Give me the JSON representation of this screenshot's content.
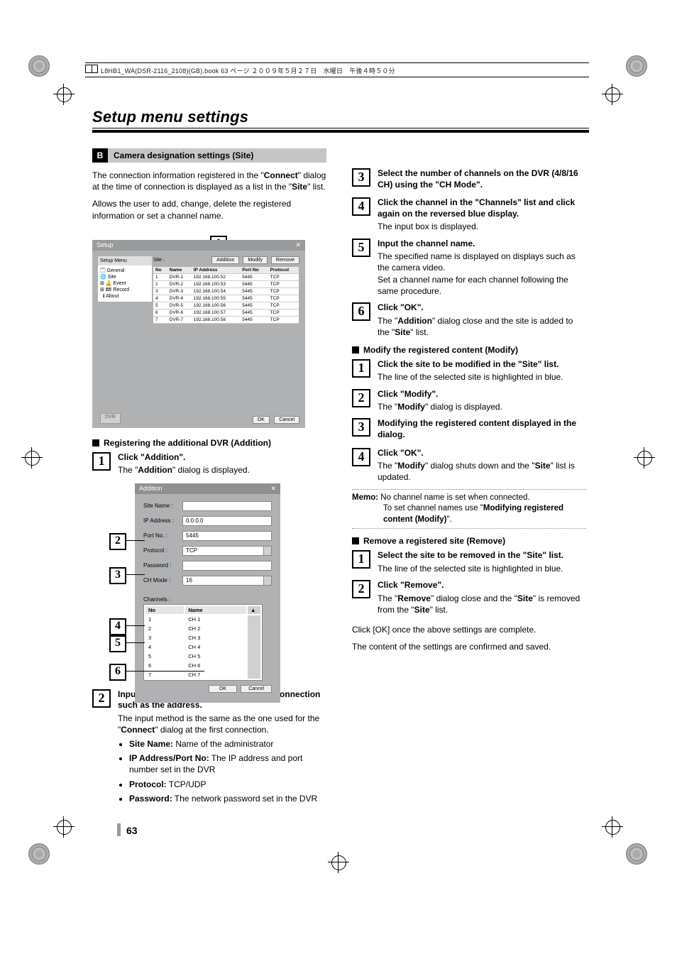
{
  "meta_header": "L8HB1_WA(DSR-2116_2108)(GB).book   63 ページ   ２００９年５月２７日　水曜日　午後４時５０分",
  "page_title": "Setup menu settings",
  "section_letter": "B",
  "section_label": "Camera designation settings (Site)",
  "intro_p1_a": "The connection information registered in the \"",
  "intro_p1_b": "Connect",
  "intro_p1_c": "\" dialog at the time of connection is displayed as a list in the \"",
  "intro_p1_d": "Site",
  "intro_p1_e": "\" list.",
  "intro_p2": "Allows the user to add, change, delete the registered information or set a channel name.",
  "setup_dialog": {
    "title": "Setup",
    "menu_label": "Setup Menu",
    "tree": [
      "General",
      "Site",
      "Event",
      "Record",
      "About"
    ],
    "site_label": "Site :",
    "btn_add": "Addition",
    "btn_mod": "Modify",
    "btn_rem": "Remove",
    "cols": [
      "No",
      "Name",
      "IP Address",
      "Port No",
      "Protocol"
    ],
    "rows": [
      [
        "1",
        "DVR-1",
        "192.168.100.52",
        "5445",
        "TCP"
      ],
      [
        "2",
        "DVR-2",
        "192.168.100.53",
        "5445",
        "TCP"
      ],
      [
        "3",
        "DVR-3",
        "192.168.100.54",
        "5445",
        "TCP"
      ],
      [
        "4",
        "DVR-4",
        "192.168.100.55",
        "5445",
        "TCP"
      ],
      [
        "5",
        "DVR-5",
        "192.168.100.56",
        "5445",
        "TCP"
      ],
      [
        "6",
        "DVR-6",
        "192.168.100.57",
        "5445",
        "TCP"
      ],
      [
        "7",
        "DVR-7",
        "192.168.100.58",
        "5445",
        "TCP"
      ]
    ],
    "btn_dvr": "DVR",
    "btn_ok": "OK",
    "btn_cancel": "Cancel"
  },
  "sub_register": "Registering the additional DVR (Addition)",
  "left_steps": {
    "s1_hd": "Click \"Addition\".",
    "s1_tx_a": "The \"",
    "s1_tx_b": "Addition",
    "s1_tx_c": "\" dialog is displayed.",
    "s2_hd": "Input the information necessary to the connection such as the address.",
    "s2_tx_a": "The input method is the same as the one used for the \"",
    "s2_tx_b": "Connect",
    "s2_tx_c": "\" dialog at the first connection.",
    "b_sitename": "Site Name:",
    "t_sitename": " Name of the administrator",
    "b_ipport": "IP Address/Port No:",
    "t_ipport": " The IP address and port number set in the DVR",
    "b_proto": "Protocol:",
    "t_proto": " TCP/UDP",
    "b_pwd": "Password:",
    "t_pwd": " The network password set in the DVR"
  },
  "addition_dialog": {
    "title": "Addition",
    "f_sitename": "Site Name :",
    "f_ip": "IP Address :",
    "v_ip": "0.0.0.0",
    "f_port": "Port No. :",
    "v_port": "5445",
    "f_proto": "Protocol :",
    "v_proto": "TCP",
    "f_pwd": "Password :",
    "f_chmode": "CH Mode :",
    "v_chmode": "16",
    "f_channels": "Channels :",
    "ch_cols": [
      "No",
      "Name"
    ],
    "ch_rows": [
      [
        "1",
        "CH 1"
      ],
      [
        "2",
        "CH 2"
      ],
      [
        "3",
        "CH 3"
      ],
      [
        "4",
        "CH 4"
      ],
      [
        "5",
        "CH 5"
      ],
      [
        "6",
        "CH 6"
      ],
      [
        "7",
        "CH 7"
      ]
    ],
    "btn_ok": "OK",
    "btn_cancel": "Cancel"
  },
  "right": {
    "s3_hd": "Select the number of channels on the DVR (4/8/16 CH) using the \"CH Mode\".",
    "s4_hd": "Click the channel in the \"Channels\" list and click again on the reversed blue display.",
    "s4_tx": "The input box is displayed.",
    "s5_hd": "Input the channel name.",
    "s5_tx1": "The specified name is displayed on displays such as the camera video.",
    "s5_tx2": "Set a channel name for each channel following the same procedure.",
    "s6_hd": "Click \"OK\".",
    "s6_tx_a": "The \"",
    "s6_tx_b": "Addition",
    "s6_tx_c": "\" dialog close and the site is added to the \"",
    "s6_tx_d": "Site",
    "s6_tx_e": "\" list.",
    "sub_modify": "Modify the registered content (Modify)",
    "m1_hd": "Click the site to be modified in the \"Site\" list.",
    "m1_tx": "The line of the selected site is highlighted in blue.",
    "m2_hd": "Click \"Modify\".",
    "m2_tx_a": "The \"",
    "m2_tx_b": "Modify",
    "m2_tx_c": "\" dialog is displayed.",
    "m3_hd": "Modifying the registered content displayed in the dialog.",
    "m4_hd": "Click \"OK\".",
    "m4_tx_a": "The \"",
    "m4_tx_b": "Modify",
    "m4_tx_c": "\" dialog shuts down and the \"",
    "m4_tx_d": "Site",
    "m4_tx_e": "\" list is updated.",
    "memo_lbl": "Memo:",
    "memo_1": " No channel name is set when connected.",
    "memo_2a": "To set channel names use \"",
    "memo_2b": "Modifying registered content (Modify)",
    "memo_2c": "\".",
    "sub_remove": "Remove a registered site (Remove)",
    "r1_hd": "Select the site to be removed in the \"Site\" list.",
    "r1_tx": "The line of the selected site is highlighted in blue.",
    "r2_hd": "Click \"Remove\".",
    "r2_tx_a": "The \"",
    "r2_tx_b": "Remove",
    "r2_tx_c": "\" dialog close and the \"",
    "r2_tx_d": "Site",
    "r2_tx_e": "\" is removed from the \"",
    "r2_tx_f": "Site",
    "r2_tx_g": "\" list.",
    "tail1": "Click [OK] once the above settings are complete.",
    "tail2": "The content of the settings are confirmed and saved."
  },
  "callout_1": "1",
  "callout_2": "2",
  "callout_3": "3",
  "callout_4": "4",
  "callout_5": "5",
  "callout_6": "6",
  "pagenum": "63"
}
